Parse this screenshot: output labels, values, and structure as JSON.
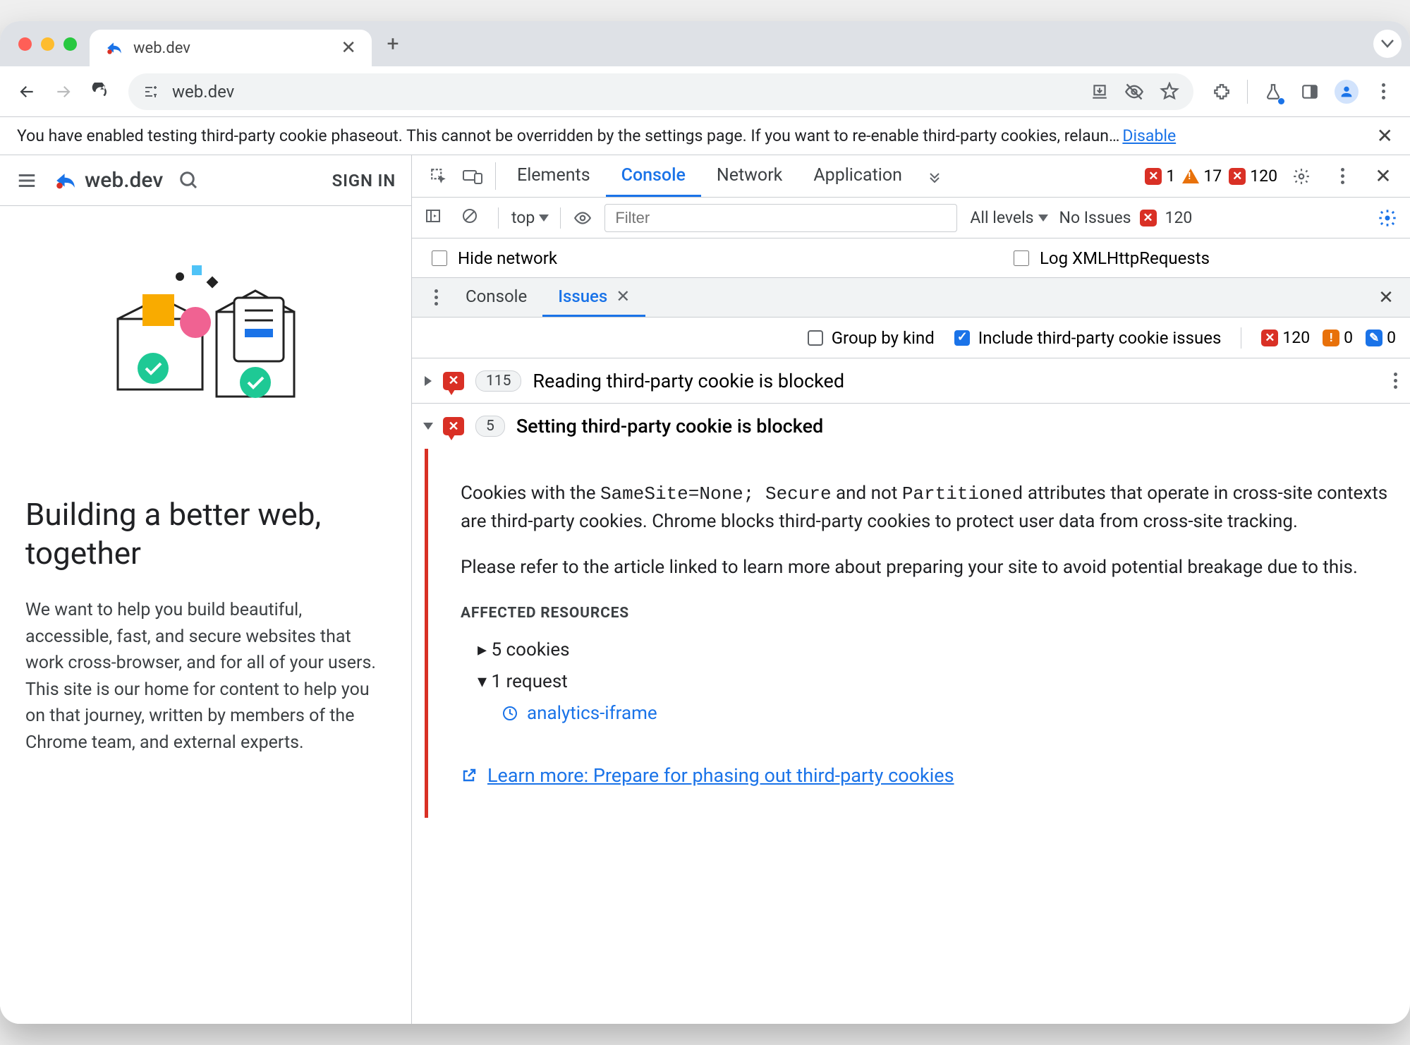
{
  "browser": {
    "tab_title": "web.dev",
    "address": "web.dev",
    "new_tab": "+"
  },
  "warning": {
    "text": "You have enabled testing third-party cookie phaseout. This cannot be overridden by the settings page. If you want to re-enable third-party cookies, relaun…",
    "disable": "Disable"
  },
  "page": {
    "brand": "web.dev",
    "signin": "SIGN IN",
    "heading": "Building a better web, together",
    "blurb": "We want to help you build beautiful, accessible, fast, and secure websites that work cross-browser, and for all of your users. This site is our home for content to help you on that journey, written by members of the Chrome team, and external experts."
  },
  "devtools": {
    "tabs": {
      "elements": "Elements",
      "console": "Console",
      "network": "Network",
      "application": "Application"
    },
    "counts": {
      "errors": "1",
      "warnings": "17",
      "blocked": "120"
    },
    "context": "top",
    "filter_placeholder": "Filter",
    "levels": "All levels",
    "no_issues": "No Issues",
    "no_issues_count": "120",
    "hide_network": "Hide network",
    "log_xhr": "Log XMLHttpRequests",
    "drawer": {
      "console": "Console",
      "issues": "Issues"
    },
    "issues_bar": {
      "group": "Group by kind",
      "include": "Include third-party cookie issues",
      "c1": "120",
      "c2": "0",
      "c3": "0"
    },
    "issue1": {
      "count": "115",
      "title": "Reading third-party cookie is blocked"
    },
    "issue2": {
      "count": "5",
      "title": "Setting third-party cookie is blocked",
      "p1a": "Cookies with the ",
      "p1b": "SameSite=None; Secure",
      "p1c": " and not ",
      "p1d": "Partitioned",
      "p1e": " attributes that operate in cross-site contexts are third-party cookies. Chrome blocks third-party cookies to protect user data from cross-site tracking.",
      "p2": "Please refer to the article linked to learn more about preparing your site to avoid potential breakage due to this.",
      "affected": "AFFECTED RESOURCES",
      "cookies": "5 cookies",
      "requests": "1 request",
      "req1": "analytics-iframe",
      "learn": "Learn more: Prepare for phasing out third-party cookies"
    }
  }
}
